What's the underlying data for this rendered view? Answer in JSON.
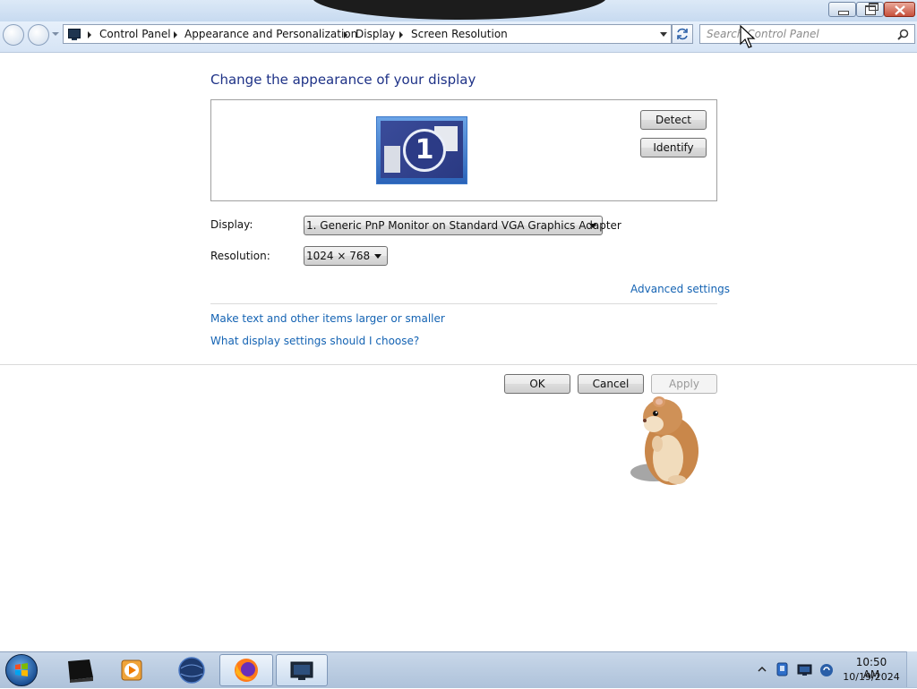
{
  "navigation": {
    "breadcrumbs": [
      "Control Panel",
      "Appearance and Personalization",
      "Display",
      "Screen Resolution"
    ],
    "search_placeholder": "Search Control Panel"
  },
  "content": {
    "heading": "Change the appearance of your display",
    "preview": {
      "monitor_number": "1"
    },
    "detect_label": "Detect",
    "identify_label": "Identify",
    "display_label": "Display:",
    "display_value": "1. Generic PnP Monitor on Standard VGA Graphics Adapter",
    "resolution_label": "Resolution:",
    "resolution_value": "1024 × 768",
    "advanced_link": "Advanced settings",
    "larger_link": "Make text and other items larger or smaller",
    "choose_link": "What display settings should I choose?"
  },
  "dialog_buttons": {
    "ok": "OK",
    "cancel": "Cancel",
    "apply": "Apply"
  },
  "taskbar": {
    "pinned": [
      "start-orb",
      "media-icon",
      "vlc-icon",
      "globe-icon",
      "firefox-icon",
      "display-window-icon"
    ],
    "clock_time": "10:50 AM",
    "clock_date": "10/19/2024"
  },
  "colors": {
    "heading": "#1e3287",
    "link": "#1463b3",
    "taskbar": "#b9cbe0"
  }
}
